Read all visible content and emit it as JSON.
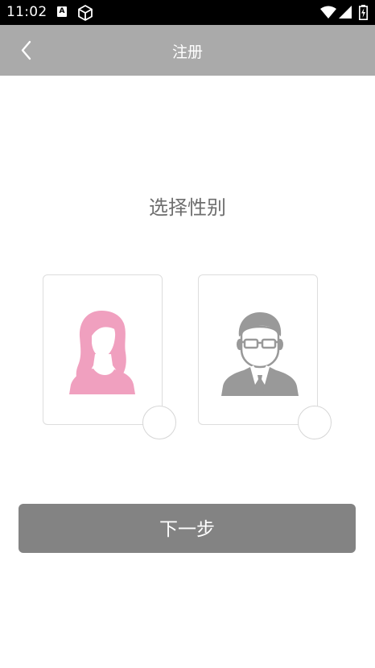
{
  "status_bar": {
    "time": "11:02",
    "notification_icons": [
      "a-badge-icon",
      "cube-icon"
    ],
    "system_icons": [
      "wifi-icon",
      "signal-icon",
      "battery-icon"
    ]
  },
  "toolbar": {
    "back_icon": "chevron-left-icon",
    "title": "注册"
  },
  "main": {
    "heading": "选择性别",
    "options": [
      {
        "id": "female",
        "avatar_icon": "female-avatar-icon",
        "avatar_color": "#f0a0bf",
        "selected": false
      },
      {
        "id": "male",
        "avatar_icon": "male-avatar-icon",
        "avatar_color": "#999999",
        "selected": false
      }
    ],
    "next_label": "下一步"
  },
  "colors": {
    "toolbar_bg": "#aaaaaa",
    "button_bg": "#838383",
    "heading_text": "#6e6e6e"
  }
}
